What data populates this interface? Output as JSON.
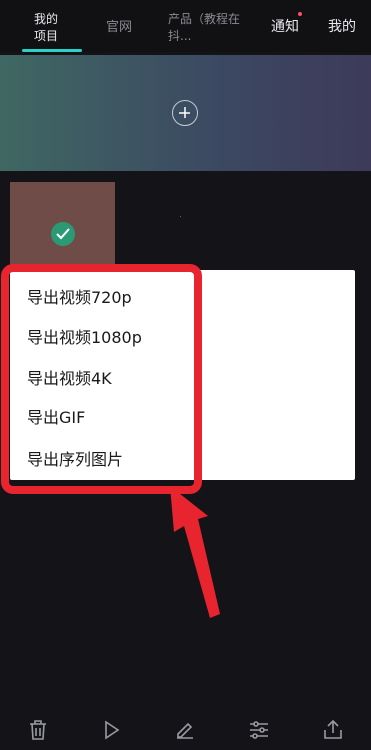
{
  "nav": {
    "tab_projects": "我的项目",
    "tab_official": "官网",
    "tab_product": "产品（教程在抖...",
    "tab_notify": "通知",
    "tab_mine": "我的"
  },
  "export_menu": {
    "items": [
      "导出视频720p",
      "导出视频1080p",
      "导出视频4K",
      "导出GIF",
      "导出序列图片"
    ]
  },
  "toolbar": {
    "icons": [
      "trash-icon",
      "play-icon",
      "edit-icon",
      "sliders-icon",
      "share-icon"
    ]
  },
  "colors": {
    "accent": "#2ad2c9",
    "highlight": "#e8252e",
    "background": "#141418"
  }
}
